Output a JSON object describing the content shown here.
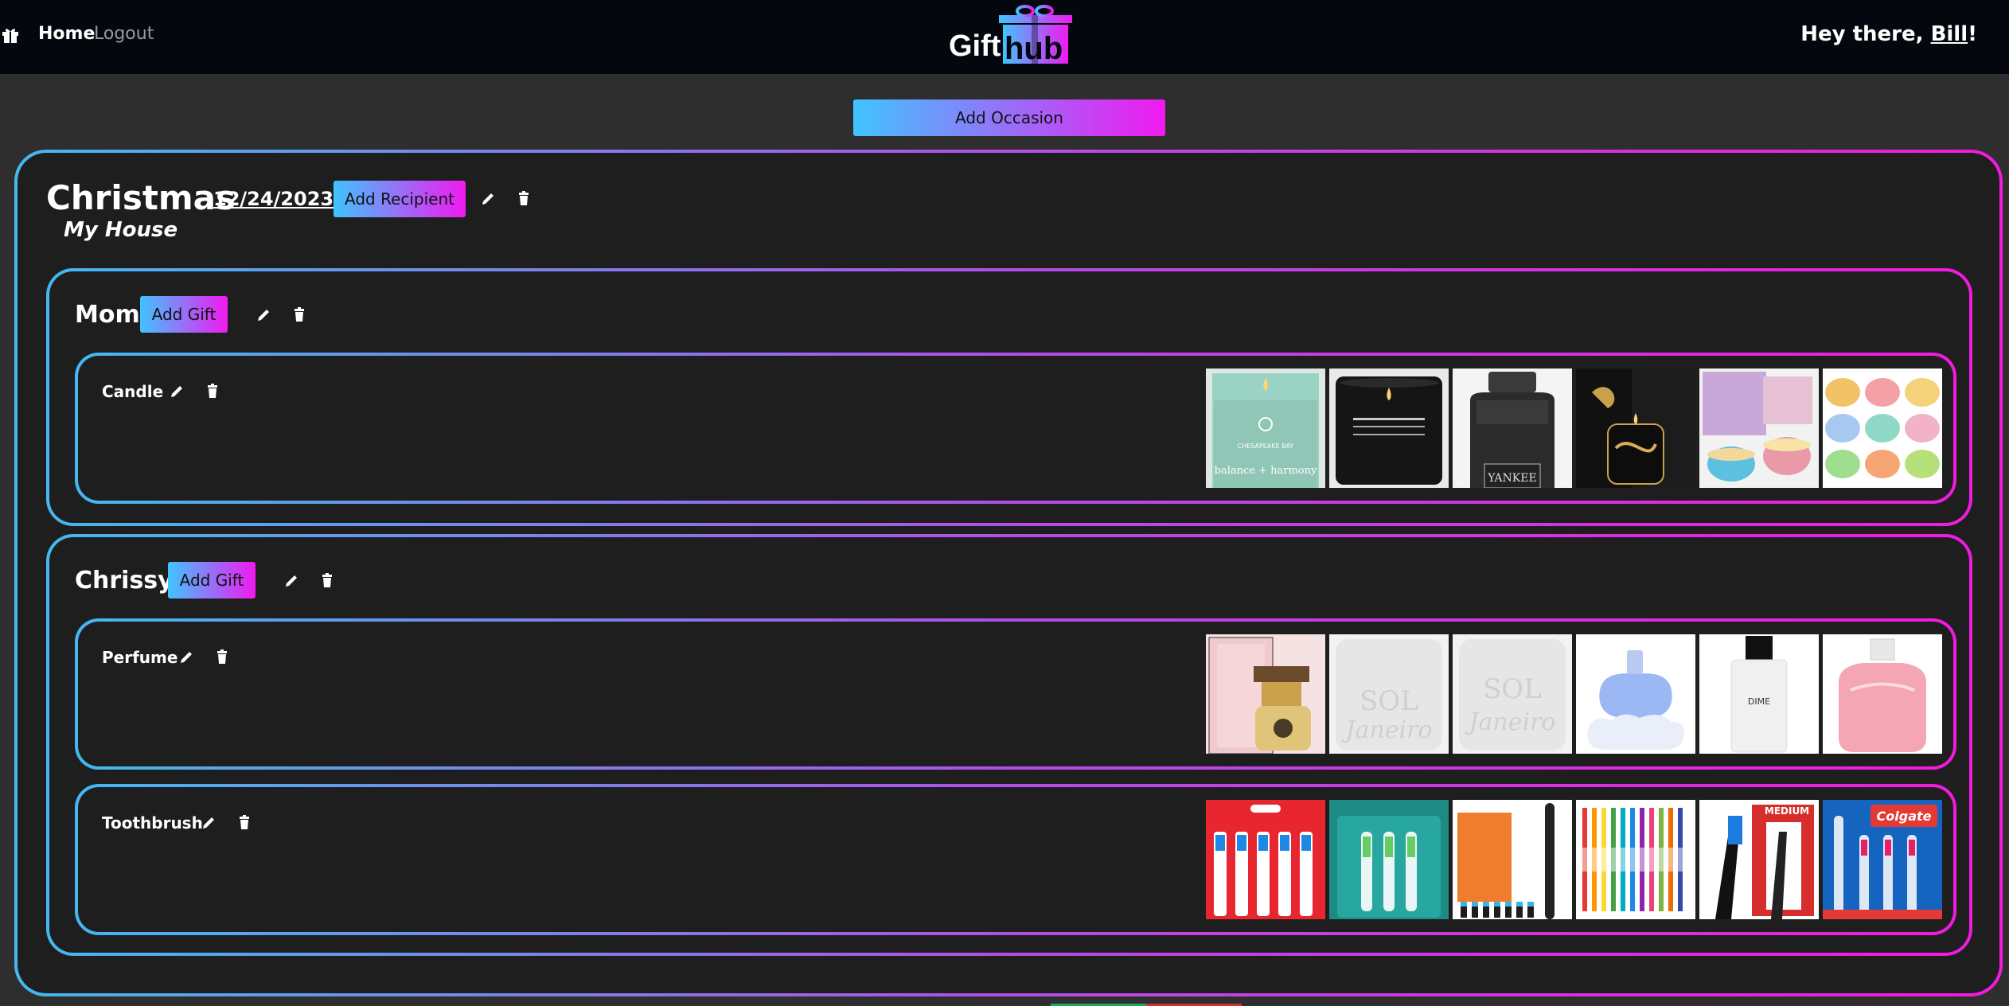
{
  "nav": {
    "home_label": "Home",
    "logout_label": "Logout",
    "logo_text_left": "Gift",
    "logo_text_right": "hub",
    "greeting_prefix": "Hey there, ",
    "user_name": "Bill",
    "greeting_suffix": "!"
  },
  "actions": {
    "add_occasion_label": "Add Occasion",
    "add_recipient_label": "Add Recipient",
    "add_gift_label": "Add Gift"
  },
  "occasion": {
    "title": "Christmas",
    "date": "12/24/2023",
    "location": "My House",
    "recipients": [
      {
        "name": "Mom",
        "gifts": [
          {
            "name": "Candle",
            "thumbnails": [
              "sage-candle-jar",
              "black-candle-tin",
              "yankee-jar-candle",
              "black-gold-candle",
              "floral-candle-tins",
              "pastel-candle-tins"
            ],
            "thumbnail_text": [
              "CHESAPEAKE BAY",
              "balance + harmony",
              "YANKEE"
            ]
          }
        ]
      },
      {
        "name": "Chrissy",
        "gifts": [
          {
            "name": "Perfume",
            "thumbnails": [
              "juicy-couture-perfume",
              "sol-de-janeiro-jar",
              "sol-de-janeiro-jar",
              "cloud-perfume-bottle",
              "dime-perfume-bottle",
              "pink-perfume-bottle"
            ],
            "thumbnail_text": [
              "SOL",
              "Janeiro",
              "DIME"
            ]
          },
          {
            "name": "Toothbrush",
            "thumbnails": [
              "red-toothbrush-pack",
              "teal-toothbrush-pack",
              "electric-toothbrush-box",
              "multicolor-toothbrush-set",
              "black-toothbrush-pair",
              "colgate-toothbrush-pack"
            ],
            "thumbnail_text": [
              "MEDIUM",
              "Colgate"
            ]
          }
        ]
      }
    ]
  },
  "colors": {
    "gradient_start": "#43b9ef",
    "gradient_end": "#f21ae0",
    "nav_bg": "#04080e",
    "card_bg": "#1e1e1e",
    "page_bg": "#2e2e2e"
  }
}
